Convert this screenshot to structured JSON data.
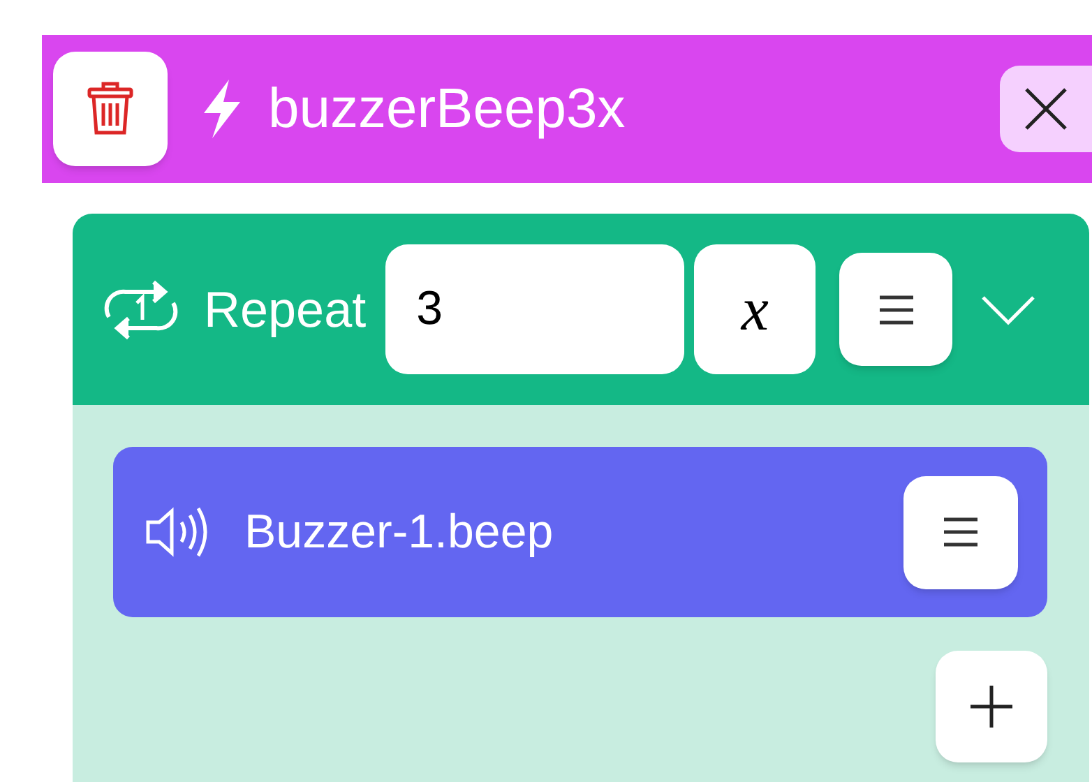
{
  "header": {
    "title": "buzzerBeep3x"
  },
  "repeat_block": {
    "label": "Repeat",
    "count": "3",
    "variable_button": "x",
    "expanded": true,
    "children": [
      {
        "kind": "action",
        "label": "Buzzer-1.beep"
      }
    ]
  }
}
